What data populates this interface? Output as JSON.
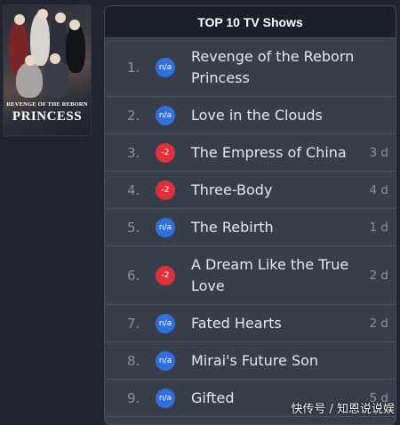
{
  "header": {
    "title": "TOP 10 TV Shows"
  },
  "poster": {
    "alt": "Revenge of the Reborn Princess poster",
    "title_line1": "REVENGE OF THE REBORN",
    "title_line2": "PRINCESS"
  },
  "shows": [
    {
      "rank": "1.",
      "badge": "n/a",
      "badge_color": "#2f6fe0",
      "title": "Revenge of the Reborn Princess",
      "days": ""
    },
    {
      "rank": "2.",
      "badge": "n/a",
      "badge_color": "#2f6fe0",
      "title": "Love in the Clouds",
      "days": ""
    },
    {
      "rank": "3.",
      "badge": "-2",
      "badge_color": "#e0303a",
      "title": "The Empress of China",
      "days": "3 d"
    },
    {
      "rank": "4.",
      "badge": "-2",
      "badge_color": "#e0303a",
      "title": "Three-Body",
      "days": "4 d"
    },
    {
      "rank": "5.",
      "badge": "n/a",
      "badge_color": "#2f6fe0",
      "title": "The Rebirth",
      "days": "1 d"
    },
    {
      "rank": "6.",
      "badge": "-2",
      "badge_color": "#e0303a",
      "title": "A Dream Like the True Love",
      "days": "2 d"
    },
    {
      "rank": "7.",
      "badge": "n/a",
      "badge_color": "#2f6fe0",
      "title": "Fated Hearts",
      "days": "2 d"
    },
    {
      "rank": "8.",
      "badge": "n/a",
      "badge_color": "#2f6fe0",
      "title": "Mirai's Future Son",
      "days": ""
    },
    {
      "rank": "9.",
      "badge": "n/a",
      "badge_color": "#2f6fe0",
      "title": "Gifted",
      "days": "5 d"
    }
  ],
  "watermark": "快传号 / 知恩说说娱"
}
